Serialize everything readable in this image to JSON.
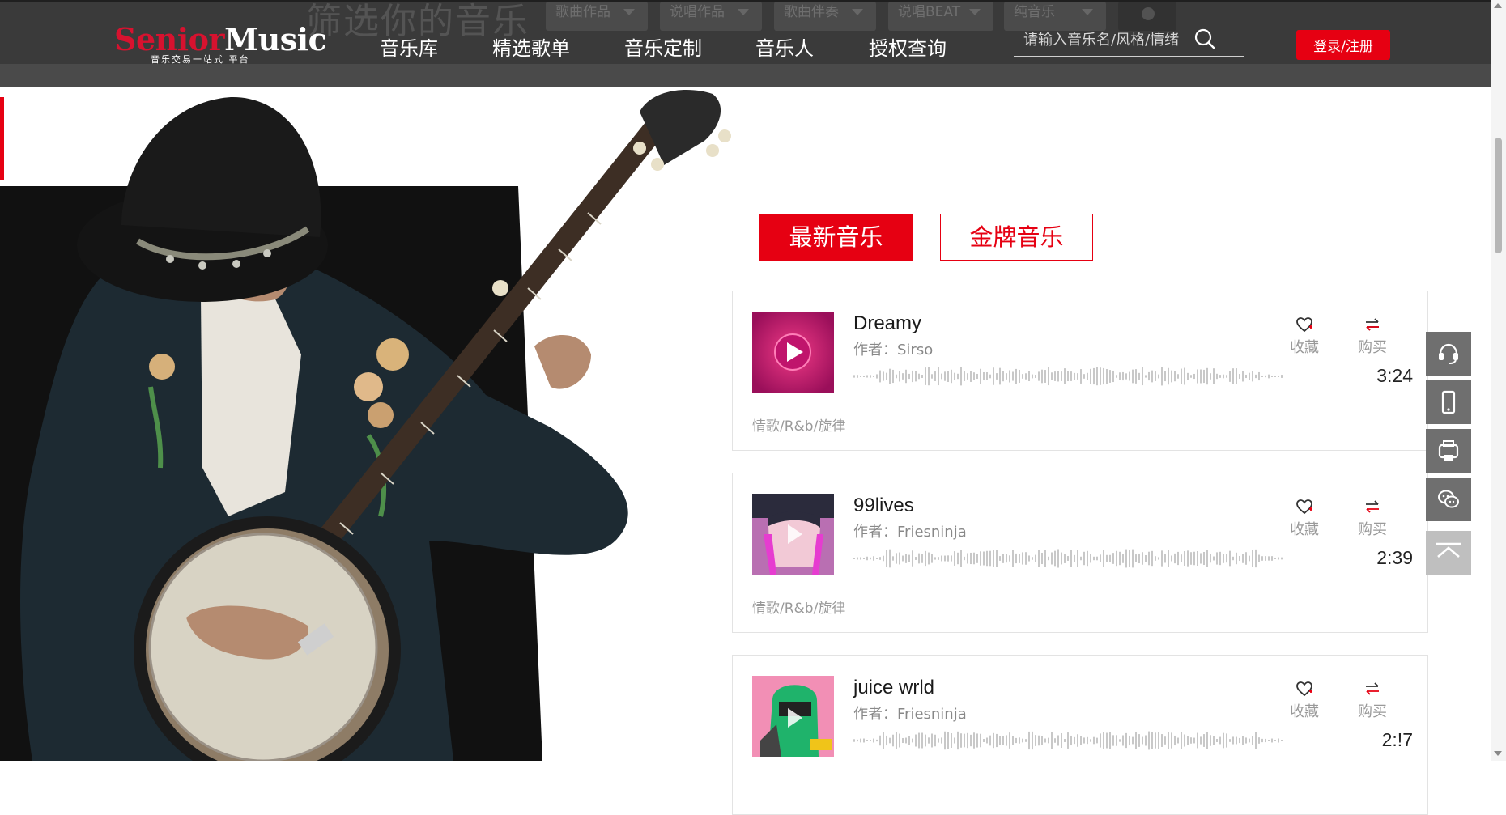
{
  "header": {
    "logo_senior": "Senior",
    "logo_music": "Music",
    "logo_tagline": "音乐交易一站式 平台",
    "nav": [
      {
        "label": "音乐库"
      },
      {
        "label": "精选歌单"
      },
      {
        "label": "音乐定制"
      },
      {
        "label": "音乐人"
      },
      {
        "label": "授权查询"
      }
    ],
    "search_placeholder": "请输入音乐名/风格/情绪",
    "login_label": "登录/注册"
  },
  "filter_bar": {
    "title": "筛选你的音乐",
    "chips": [
      "歌曲作品",
      "说唱作品",
      "歌曲伴奏",
      "说唱BEAT",
      "纯音乐"
    ]
  },
  "tabs": [
    {
      "label": "最新音乐",
      "active": true
    },
    {
      "label": "金牌音乐",
      "active": false
    }
  ],
  "songs": [
    {
      "title": "Dreamy",
      "author": "作者：Sirso",
      "duration": "3:24",
      "tags": "情歌/R&b/旋律",
      "fav_label": "收藏",
      "buy_label": "购买"
    },
    {
      "title": "99lives",
      "author": "作者：Friesninja",
      "duration": "2:39",
      "tags": "情歌/R&b/旋律",
      "fav_label": "收藏",
      "buy_label": "购买"
    },
    {
      "title": "juice wrld",
      "author": "作者：Friesninja",
      "duration": "2:!7",
      "tags": "",
      "fav_label": "收藏",
      "buy_label": "购买"
    }
  ],
  "float_tools": [
    {
      "icon": "customer-service-icon"
    },
    {
      "icon": "mobile-phone-icon"
    },
    {
      "icon": "app-icon"
    },
    {
      "icon": "wechat-icon"
    },
    {
      "icon": "back-to-top-icon"
    }
  ],
  "colors": {
    "accent": "#e60012",
    "header_bg": "#3a3a3a"
  }
}
